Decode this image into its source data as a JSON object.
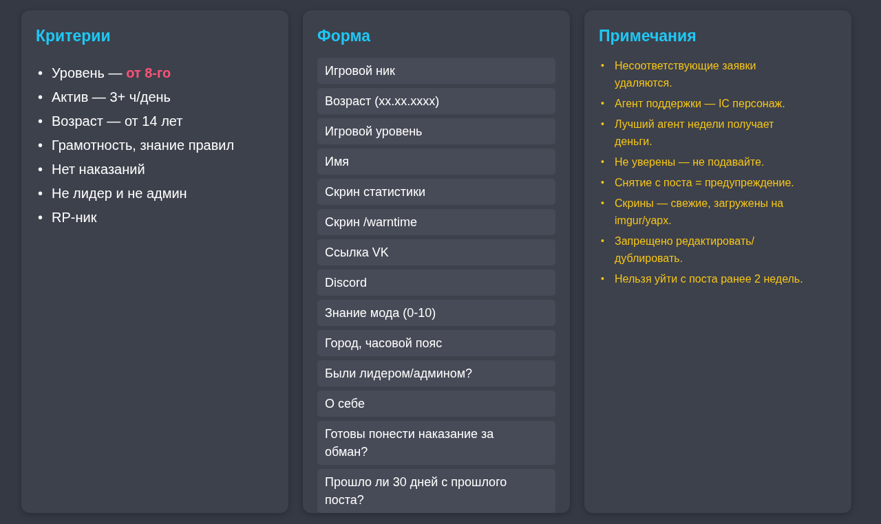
{
  "columns": [
    {
      "kind": "criteria",
      "title": "Критерии",
      "marker": "•",
      "items": [
        "Уровень — **от 8-го**",
        "Актив — 3+ ч/день",
        "Возраст — от 14 лет",
        "Грамотность, знание правил",
        "Нет наказаний",
        "Не лидер и не админ",
        "RP-ник"
      ]
    },
    {
      "kind": "form",
      "title": "Форма",
      "items": [
        "Игровой ник",
        "Возраст (xx.xx.xxxx)",
        "Игровой уровень",
        "Имя",
        "Скрин статистики",
        "Скрин /warntime",
        "Ссылка VK",
        "Discord",
        "Знание мода (0-10)",
        "Город, часовой пояс",
        "Были лидером/админом?",
        "О себе",
        "Готовы понести наказание за обман?",
        "Прошло ли 30 дней с прошлого поста?"
      ]
    },
    {
      "kind": "notes",
      "title": "Примечания",
      "marker": "•",
      "items": [
        "Несоответствующие заявки удаляются.",
        "Агент поддержки — IC персонаж.",
        "Лучший агент недели получает деньги.",
        "Не уверены — не подавайте.",
        "Снятие с поста = предупреждение.",
        "Скрины — свежие, загружены на imgur/yapx.",
        "Запрещено редактировать/ дублировать.",
        "Нельзя уйти с поста ранее 2 недель."
      ]
    }
  ]
}
